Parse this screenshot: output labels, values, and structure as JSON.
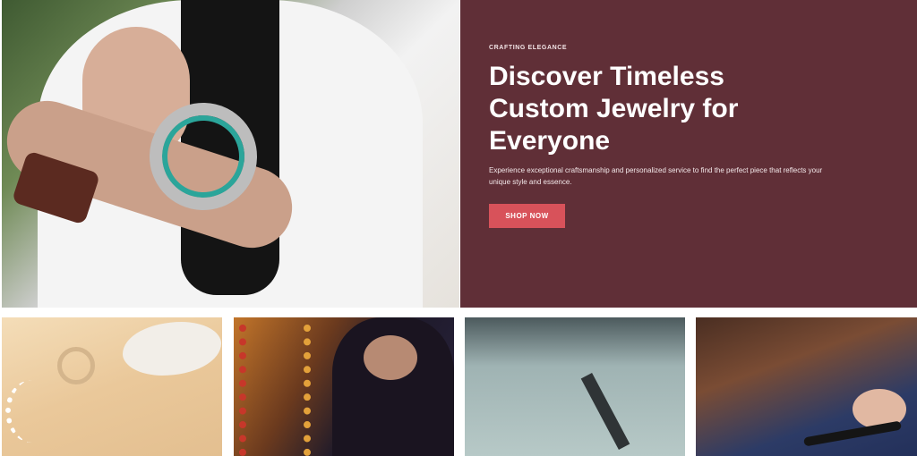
{
  "hero": {
    "eyebrow": "CRAFTING ELEGANCE",
    "headline": "Discover Timeless Custom Jewelry for Everyone",
    "description": "Experience exceptional craftsmanship and personalized service to find the perfect piece that reflects your unique style and essence.",
    "cta_label": "SHOP NOW",
    "panel_color": "#602f37",
    "cta_color": "#d8525a"
  },
  "gallery": {
    "tiles": [
      {
        "subject": "pearl and ring jewelry pieces"
      },
      {
        "subject": "woman with beaded necklaces"
      },
      {
        "subject": "jeweler workbench with tool"
      },
      {
        "subject": "hands crafting jewelry"
      }
    ]
  }
}
